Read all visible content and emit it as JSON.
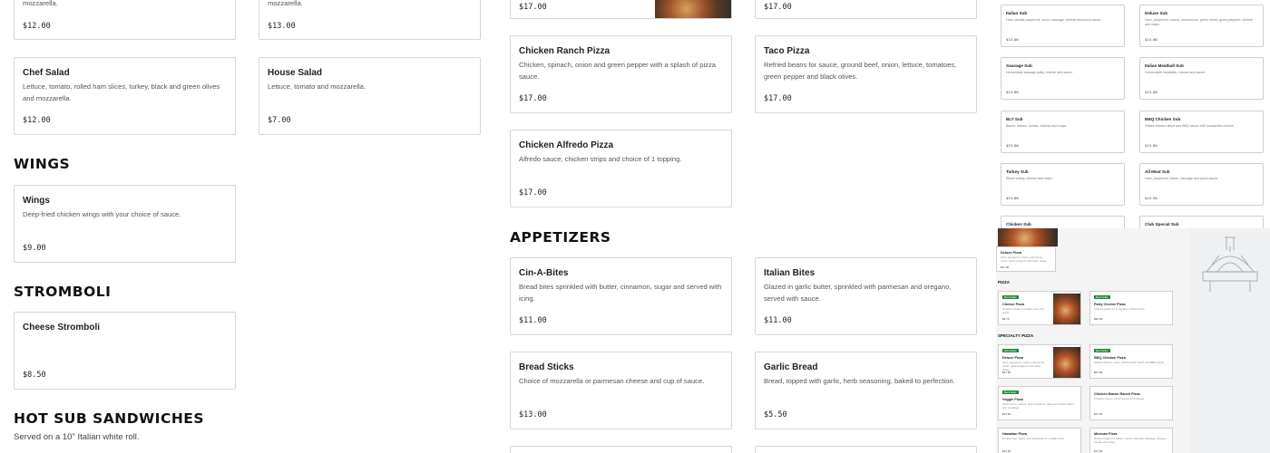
{
  "salads": {
    "partial_a_desc": "mozzarella.",
    "partial_a_price": "$12.00",
    "partial_b_desc": "mozzarella.",
    "partial_b_price": "$13.00",
    "chef": {
      "title": "Chef Salad",
      "desc": "Lettuce, tomato, rolled ham slices, turkey, black and green olives and mozzarella.",
      "price": "$12.00"
    },
    "house": {
      "title": "House Salad",
      "desc": "Lettuce, tomato and mozzarella.",
      "price": "$7.00"
    }
  },
  "wings": {
    "heading": "WINGS",
    "item": {
      "title": "Wings",
      "desc": "Deep-fried chicken wings with your choice of sauce.",
      "price": "$9.00"
    }
  },
  "stromboli": {
    "heading": "STROMBOLI",
    "item": {
      "title": "Cheese Stromboli",
      "price": "$8.50"
    }
  },
  "subs_section": {
    "heading": "HOT SUB SANDWICHES",
    "subheading": "Served on a 10\" Italian white roll."
  },
  "pizzas": {
    "partial_a_price": "$17.00",
    "partial_b_price": "$17.00",
    "chicken_ranch": {
      "title": "Chicken Ranch Pizza",
      "desc": "Chicken, spinach, onion and green pepper with a splash of pizza sauce.",
      "price": "$17.00"
    },
    "taco": {
      "title": "Taco Pizza",
      "desc": "Refried beans for sauce, ground beef, onion, lettuce, tomatoes, green pepper and black olives.",
      "price": "$17.00"
    },
    "chicken_alfredo": {
      "title": "Chicken Alfredo Pizza",
      "desc": "Alfredo sauce, chicken strips and choice of 1 topping.",
      "price": "$17.00"
    }
  },
  "appetizers": {
    "heading": "APPETIZERS",
    "cin_a_bites": {
      "title": "Cin-A-Bites",
      "desc": "Bread bites sprinkled with butter, cinnamon, sugar and served with icing.",
      "price": "$11.00"
    },
    "italian_bites": {
      "title": "Italian Bites",
      "desc": "Glazed in garlic butter, sprinkled with parmesan and oregano, served with sauce.",
      "price": "$11.00"
    },
    "bread_sticks": {
      "title": "Bread Sticks",
      "desc": "Choice of mozzarella or parmesan cheese and cup of sauce.",
      "price": "$13.00"
    },
    "garlic_bread": {
      "title": "Garlic Bread",
      "desc": "Bread, topped with garlic, herb seasoning, baked to perfection.",
      "price": "$5.50"
    }
  },
  "mini_subs": [
    {
      "title": "Italian Sub",
      "desc": "Ham, double pepperoni, onion, sausage, cheese and pizza sauce.",
      "price": "$13.00"
    },
    {
      "title": "Deluxe Sub",
      "desc": "Ham, pepperoni, onions, mushrooms, green olives, green peppers, cheese and mayo.",
      "price": "$13.00"
    },
    {
      "title": "Sausage Sub",
      "desc": "Homemade sausage patty, cheese and sauce.",
      "price": "$13.00"
    },
    {
      "title": "Italian Meatball Sub",
      "desc": "Homemade meatballs, cheese and sauce.",
      "price": "$13.00"
    },
    {
      "title": "BLT Sub",
      "desc": "Bacon, lettuce, tomato, cheese and mayo.",
      "price": "$13.00"
    },
    {
      "title": "BBQ Chicken Sub",
      "desc": "Grilled chicken strips and BBQ sauce with mozzarella cheese.",
      "price": "$13.00"
    },
    {
      "title": "Turkey Sub",
      "desc": "Sliced turkey, cheese and mayo.",
      "price": "$13.00"
    },
    {
      "title": "All Meat Sub",
      "desc": "Ham, pepperoni, bacon, sausage and pizza sauce.",
      "price": "$13.50"
    },
    {
      "title": "Chicken Sub",
      "desc": "",
      "price": ""
    },
    {
      "title": "Club Special Sub",
      "desc": "",
      "price": ""
    }
  ],
  "overlay": {
    "top_card": {
      "title": "Deluxe Pizza",
      "desc": "Ham, pepperoni, fresh mushrooms, onion, green peppers and black olives.",
      "price": "$17.00"
    },
    "pizza_heading": "PIZZA",
    "specialty_heading": "SPECIALTY PIZZA",
    "badge": "Best Seller",
    "cards": [
      {
        "title": "Cheese Pizza",
        "desc": "Choose a base to create your own pizza.",
        "price": "$1.70",
        "badge": true
      },
      {
        "title": "Party Cheese Pizza",
        "desc": "Cheese pizza cut in squares. Thick & Pan.",
        "price": "$30.45",
        "badge": true
      },
      {
        "title": "Deluxe Pizza",
        "desc": "Ham, pepperoni, fresh mushrooms, onion, green peppers and black olives.",
        "price": "$17.00",
        "badge": true
      },
      {
        "title": "BBQ Chicken Pizza",
        "desc": "Grilled chicken, onion, drizzled with ranch and BBQ sauce.",
        "price": "$17.00",
        "badge": true
      },
      {
        "title": "Veggie Pizza",
        "desc": "Mushrooms, onions, green peppers, green and black olives and tomatoes.",
        "price": "$17.00",
        "badge": true
      },
      {
        "title": "Chicken Bacon Ranch Pizza",
        "desc": "Chicken, bacon, ranch sauce and cheese.",
        "price": "$17.00",
        "badge": false
      },
      {
        "title": "Hawaiian Pizza",
        "desc": "Double ham, bacon and pineapple on a white crust.",
        "price": "$17.00",
        "badge": false
      },
      {
        "title": "Mexican Pizza",
        "desc": "Refried beans for sauce, chorizo Mexican sausage, cheese, tomato and onion.",
        "price": "$17.00",
        "badge": false
      }
    ]
  },
  "colors": {
    "border": "#d6d6d6",
    "badge_green": "#1f8a3b",
    "overlay_bg": "#f4f4f4"
  },
  "icons": {
    "pizza_thumb": "pizza-photo",
    "pizza_oven": "pizza-oven-illustration"
  }
}
